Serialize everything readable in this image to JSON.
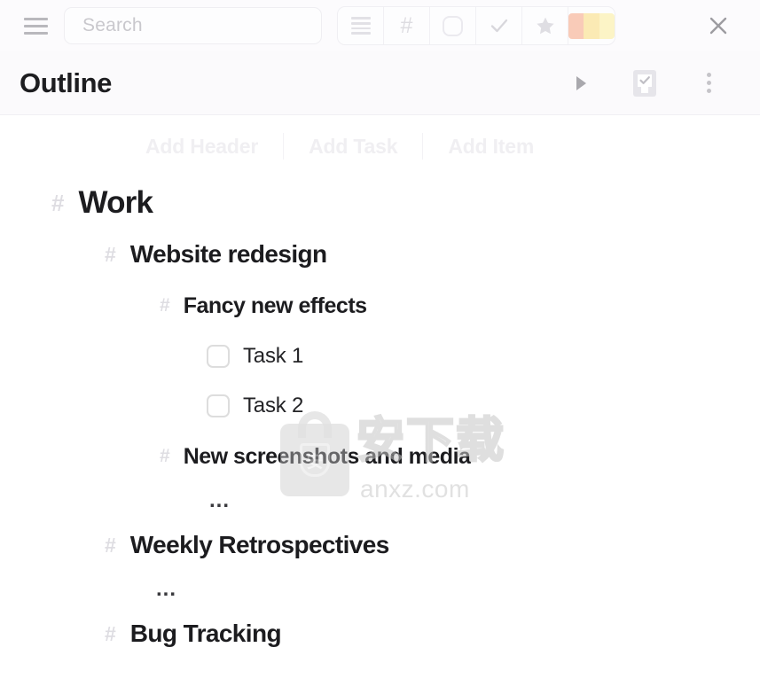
{
  "topbar": {
    "menu_icon": "hamburger-menu-icon",
    "search": {
      "placeholder": "Search",
      "value": ""
    },
    "toolbar_buttons": [
      {
        "icon": "list-lines-icon",
        "label": "List"
      },
      {
        "icon": "hash-icon",
        "label": "#"
      },
      {
        "icon": "rounded-square-icon",
        "label": "Item"
      },
      {
        "icon": "check-icon",
        "label": "Task"
      },
      {
        "icon": "star-icon",
        "label": "Favorite"
      },
      {
        "icon": "color-swatch-icon",
        "label": "Colors"
      }
    ],
    "swatch_colors": [
      "#f9cbb8",
      "#fbeab4",
      "#fcf4c6"
    ],
    "close_icon": "close-x-icon"
  },
  "header": {
    "title": "Outline",
    "actions": [
      {
        "icon": "play-triangle-icon",
        "name": "run-button"
      },
      {
        "icon": "checkbox-square-icon",
        "name": "toggle-checkboxes-button"
      },
      {
        "icon": "kebab-menu-icon",
        "name": "more-options-button"
      }
    ]
  },
  "add_row": {
    "buttons": [
      "Add Header",
      "Add Task",
      "Add Item"
    ]
  },
  "outline": {
    "nodes": [
      {
        "kind": "header",
        "level": 1,
        "text": "Work",
        "marker": "#"
      },
      {
        "kind": "header",
        "level": 2,
        "text": "Website redesign",
        "marker": "#"
      },
      {
        "kind": "header",
        "level": 3,
        "text": "Fancy new effects",
        "marker": "#"
      },
      {
        "kind": "task",
        "level": 4,
        "text": "Task 1",
        "checked": false
      },
      {
        "kind": "task",
        "level": 4,
        "text": "Task 2",
        "checked": false
      },
      {
        "kind": "header",
        "level": 3,
        "text": "New screenshots and media",
        "marker": "#"
      },
      {
        "kind": "ellipsis",
        "level": 4,
        "text": "..."
      },
      {
        "kind": "header",
        "level": 2,
        "text": "Weekly Retrospectives",
        "marker": "#"
      },
      {
        "kind": "ellipsis",
        "level": 3,
        "text": "..."
      },
      {
        "kind": "header",
        "level": 2,
        "text": "Bug Tracking",
        "marker": "#"
      }
    ]
  },
  "watermark": {
    "chinese": "安下载",
    "url": "anxz.com",
    "badge_glyph": "安"
  },
  "colors": {
    "text_primary": "#1c1c1f",
    "hash_gray": "#dedde2",
    "placeholder_gray": "#c9c8cd",
    "add_button_gray": "#f0eff2",
    "header_bg": "#fbfafc",
    "topbar_bg": "#fcfbfd"
  }
}
